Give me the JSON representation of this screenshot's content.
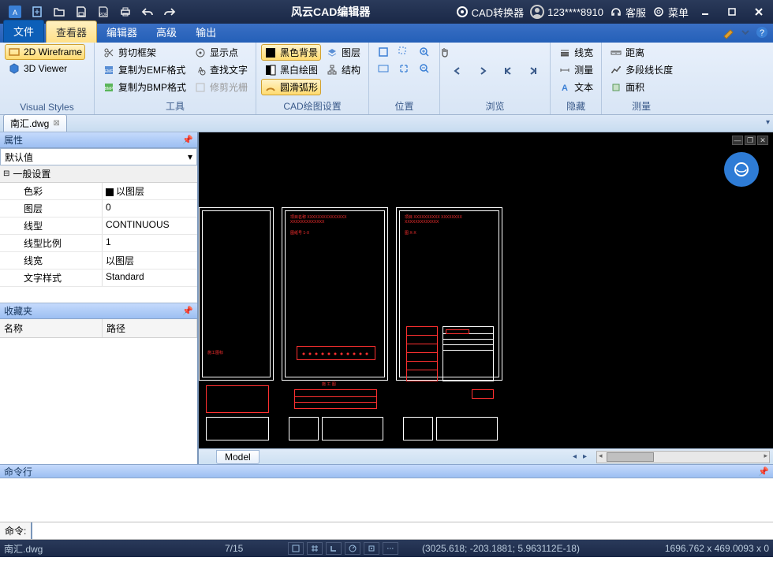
{
  "app_title": "风云CAD编辑器",
  "titlebar_right": {
    "converter": "CAD转换器",
    "user": "123****8910",
    "support": "客服",
    "menu": "菜单"
  },
  "menu_tabs": {
    "file": "文件",
    "viewer": "查看器",
    "editor": "编辑器",
    "advanced": "高级",
    "output": "输出"
  },
  "ribbon": {
    "visual_styles": {
      "wireframe": "2D Wireframe",
      "viewer3d": "3D Viewer",
      "label": "Visual Styles"
    },
    "tools": {
      "clip_frame": "剪切框架",
      "copy_emf": "复制为EMF格式",
      "copy_bmp": "复制为BMP格式",
      "show_points": "显示点",
      "find_text": "查找文字",
      "trim_raster": "修剪光栅",
      "label": "工具"
    },
    "cad_draw": {
      "black_bg": "黑色背景",
      "bw_draw": "黑白绘图",
      "smooth_arc": "圆滑弧形",
      "layer": "图层",
      "structure": "结构",
      "label": "CAD绘图设置"
    },
    "position_label": "位置",
    "browse_label": "浏览",
    "hide": {
      "linewidth": "线宽",
      "measure": "测量",
      "text": "文本",
      "label": "隐藏"
    },
    "measure": {
      "distance": "距离",
      "polyline_len": "多段线长度",
      "area": "面积",
      "label": "测量"
    }
  },
  "doc_tab": "南汇.dwg",
  "panels": {
    "properties_title": "属性",
    "default_value": "默认值",
    "general_section": "一般设置",
    "props": {
      "color_name": "色彩",
      "color_val": "以图层",
      "layer_name": "图层",
      "layer_val": "0",
      "linetype_name": "线型",
      "linetype_val": "CONTINUOUS",
      "ltscale_name": "线型比例",
      "ltscale_val": "1",
      "lineweight_name": "线宽",
      "lineweight_val": "以图层",
      "textstyle_name": "文字样式",
      "textstyle_val": "Standard"
    },
    "favorites_title": "收藏夹",
    "fav_name": "名称",
    "fav_path": "路径"
  },
  "model_tab": "Model",
  "cmdline_title": "命令行",
  "cmd_label": "命令:",
  "statusbar": {
    "file": "南汇.dwg",
    "page": "7/15",
    "coords": "(3025.618; -203.1881; 5.963112E-18)",
    "dims": "1696.762 x 469.0093 x 0"
  }
}
